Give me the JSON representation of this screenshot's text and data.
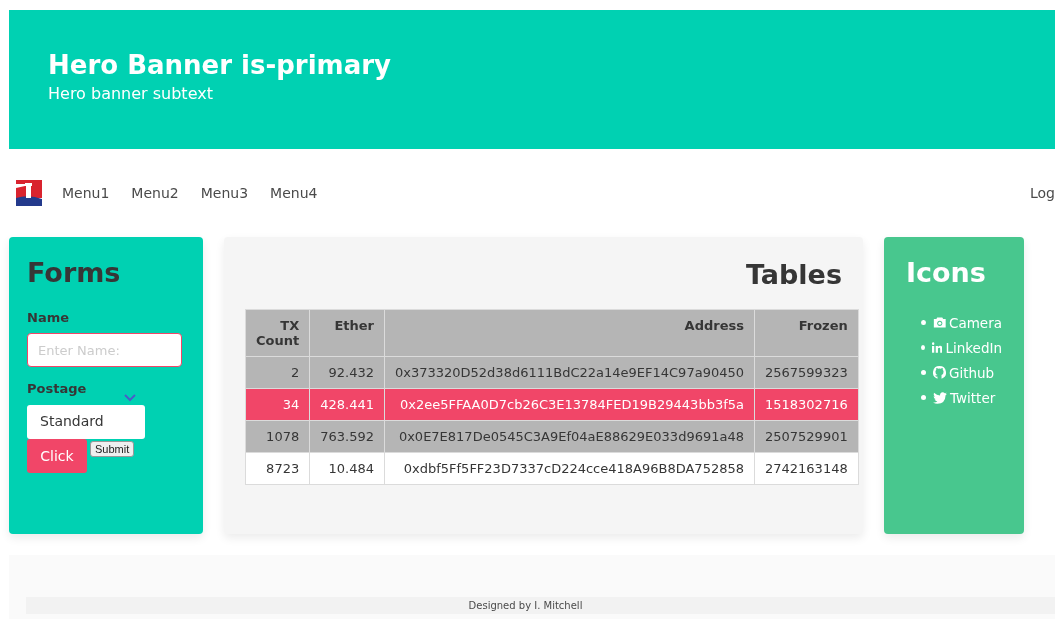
{
  "hero": {
    "title": "Hero Banner is-primary",
    "subtitle": "Hero banner subtext"
  },
  "navbar": {
    "items": [
      "Menu1",
      "Menu2",
      "Menu3",
      "Menu4"
    ],
    "end_item": "Log"
  },
  "forms": {
    "title": "Forms",
    "name_label": "Name",
    "name_placeholder": "Enter Name:",
    "postage_label": "Postage",
    "postage_value": "Standard",
    "click_button": "Click",
    "submit_button": "Submit"
  },
  "tables": {
    "title": "Tables",
    "columns": [
      "TX Count",
      "Ether",
      "Address",
      "Frozen"
    ],
    "rows": [
      {
        "cells": [
          "2",
          "92.432",
          "0x373320D52d38d6111BdC22a14e9EF14C97a90450",
          "2567599323"
        ],
        "selected": false,
        "shaded": true
      },
      {
        "cells": [
          "34",
          "428.441",
          "0x2ee5FFAA0D7cb26C3E13784FED19B29443bb3f5a",
          "1518302716"
        ],
        "selected": true,
        "shaded": false
      },
      {
        "cells": [
          "1078",
          "763.592",
          "0x0E7E817De0545C3A9Ef04aE88629E033d9691a48",
          "2507529901"
        ],
        "selected": false,
        "shaded": true
      },
      {
        "cells": [
          "8723",
          "10.484",
          "0xdbf5Ff5FF23D7337cD224cce418A96B8DA752858",
          "2742163148"
        ],
        "selected": false,
        "shaded": false
      }
    ]
  },
  "icons": {
    "title": "Icons",
    "items": [
      {
        "kind": "camera",
        "label": "Camera"
      },
      {
        "kind": "linkedin",
        "label": "LinkedIn"
      },
      {
        "kind": "github",
        "label": "Github"
      },
      {
        "kind": "twitter",
        "label": "Twitter"
      }
    ]
  },
  "footer": {
    "text": "Designed by I. Mitchell"
  }
}
